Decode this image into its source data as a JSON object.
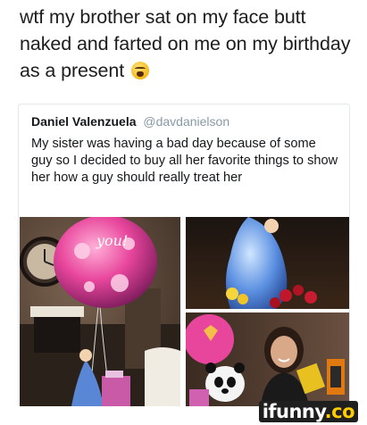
{
  "caption": {
    "text": "wtf my brother sat on my face butt naked and farted on me on my birthday as a present"
  },
  "tweet": {
    "name": "Daniel Valenzuela",
    "handle": "@davdanielson",
    "body": "My sister was having a bad day because of some guy so I decided to buy all her favorite things to show her how a guy should really treat her"
  },
  "photos": {
    "balloon_text": "you!"
  },
  "watermark": {
    "text": "ifunny",
    "suffix": ".co"
  },
  "colors": {
    "text": "#1d1d1d",
    "handle": "#8899a6",
    "card_border": "#e1e8ed",
    "watermark_bg": "#1f1f1f",
    "watermark_accent": "#ffcc00"
  }
}
